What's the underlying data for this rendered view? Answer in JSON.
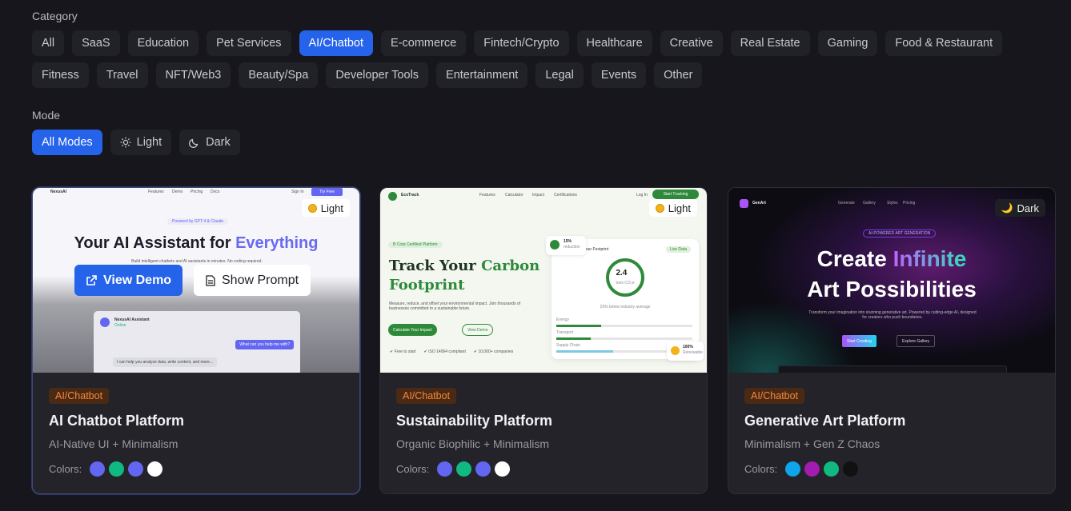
{
  "category": {
    "label": "Category",
    "items": [
      "All",
      "SaaS",
      "Education",
      "Pet Services",
      "AI/Chatbot",
      "E-commerce",
      "Fintech/Crypto",
      "Healthcare",
      "Creative",
      "Real Estate",
      "Gaming",
      "Food & Restaurant",
      "Fitness",
      "Travel",
      "NFT/Web3",
      "Beauty/Spa",
      "Developer Tools",
      "Entertainment",
      "Legal",
      "Events",
      "Other"
    ],
    "active": "AI/Chatbot"
  },
  "mode": {
    "label": "Mode",
    "items": [
      {
        "label": "All Modes",
        "icon": "none"
      },
      {
        "label": "Light",
        "icon": "sun-icon"
      },
      {
        "label": "Dark",
        "icon": "moon-icon"
      }
    ],
    "active": "All Modes"
  },
  "cards": [
    {
      "tag": "AI/Chatbot",
      "title": "AI Chatbot Platform",
      "subtitle": "AI-Native UI + Minimalism",
      "colors_label": "Colors:",
      "colors": [
        "#6366f1",
        "#10b981",
        "#6366f1",
        "#ffffff"
      ],
      "mode_badge": "Light",
      "preview": {
        "brand": "NexusAI",
        "nav": [
          "Features",
          "Demo",
          "Pricing",
          "Docs"
        ],
        "signin": "Sign In",
        "cta": "Try Free",
        "pill": "Powered by GPT-4 & Claude",
        "hero_main": "Your AI Assistant for ",
        "hero_accent": "Everything",
        "body": "Build intelligent chatbots and AI assistants in minutes. No coding required.",
        "chat_title": "NexusAI Assistant",
        "chat_status": "Online",
        "chat_user": "What can you help me with?",
        "chat_bot": "I can help you analyze data, write content, and more..."
      },
      "actions": {
        "view_demo": "View Demo",
        "show_prompt": "Show Prompt"
      }
    },
    {
      "tag": "AI/Chatbot",
      "title": "Sustainability Platform",
      "subtitle": "Organic Biophilic + Minimalism",
      "colors_label": "Colors:",
      "colors": [
        "#6366f1",
        "#10b981",
        "#6366f1",
        "#ffffff"
      ],
      "mode_badge": "Light",
      "preview": {
        "brand": "EcoTrack",
        "nav": [
          "Features",
          "Calculator",
          "Impact",
          "Certifications"
        ],
        "login": "Log In",
        "cta": "Start Tracking",
        "pill": "B Corp Certified Platform",
        "hero_main": "Track Your ",
        "hero_accent": "Carbon",
        "hero_line2": "Footprint",
        "body": "Measure, reduce, and offset your environmental impact. Join thousands of businesses committed to a sustainable future.",
        "btn_primary": "Calculate Your Impact",
        "btn_secondary": "View Demo",
        "checks": [
          "Free to start",
          "ISO 14064 compliant",
          "10,000+ companies"
        ],
        "panel_title": "Your Footprint",
        "panel_badge": "Live Data",
        "ring_value": "2.4",
        "ring_unit": "tons CO₂e",
        "ring_caption": "23% below industry average",
        "rows": [
          "Energy",
          "Transport",
          "Supply Chain"
        ],
        "float_top": "15%",
        "float_top_sub": "reduction",
        "float_bottom": "100%",
        "float_bottom_sub": "Renewable"
      }
    },
    {
      "tag": "AI/Chatbot",
      "title": "Generative Art Platform",
      "subtitle": "Minimalism + Gen Z Chaos",
      "colors_label": "Colors:",
      "colors": [
        "#0ea5e9",
        "#a21caf",
        "#10b981",
        "#111111"
      ],
      "mode_badge": "Dark",
      "preview": {
        "brand": "GenArt",
        "nav": [
          "Generate",
          "Gallery",
          "Styles",
          "Pricing"
        ],
        "pill": "AI-POWERED ART GENERATION",
        "hero_main": "Create ",
        "hero_accent": "Infinite",
        "hero_line2": "Art Possibilities",
        "body": "Transform your imagination into stunning generative art. Powered by cutting-edge AI, designed for creators who push boundaries.",
        "btn_primary": "Start Creating",
        "btn_secondary": "Explore Gallery"
      }
    }
  ]
}
